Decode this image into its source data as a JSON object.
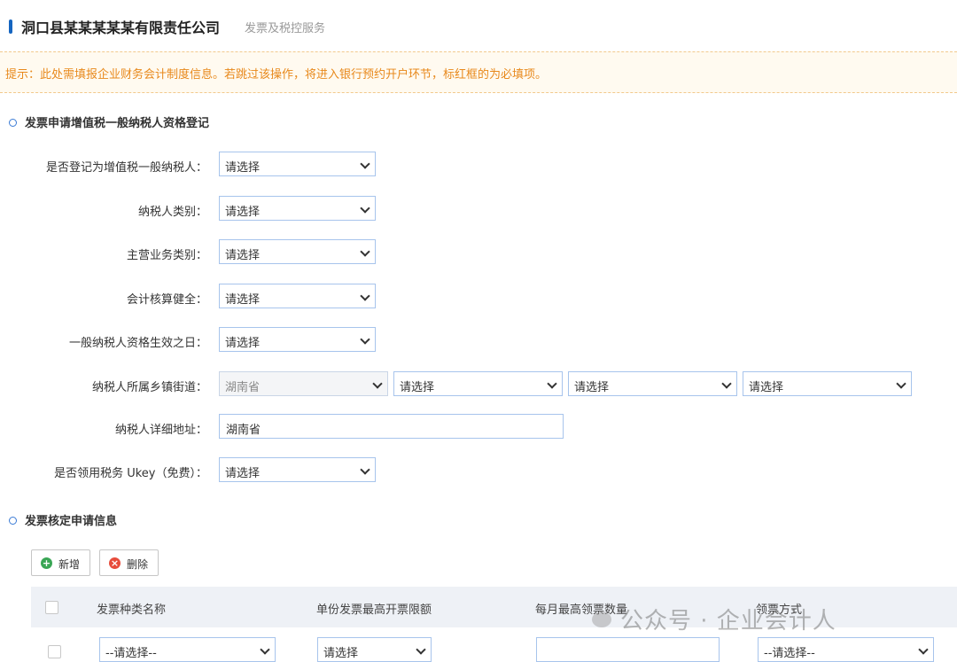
{
  "header": {
    "company": "洞口县某某某某某有限责任公司",
    "subtitle": "发票及税控服务"
  },
  "tip": "提示：此处需填报企业财务会计制度信息。若跳过该操作，将进入银行预约开户环节，标红框的为必填项。",
  "section1": {
    "title": "发票申请增值税一般纳税人资格登记",
    "fields": [
      {
        "label": "是否登记为增值税一般纳税人：",
        "value": "请选择"
      },
      {
        "label": "纳税人类别：",
        "value": "请选择"
      },
      {
        "label": "主营业务类别：",
        "value": "请选择"
      },
      {
        "label": "会计核算健全：",
        "value": "请选择"
      },
      {
        "label": "一般纳税人资格生效之日：",
        "value": "请选择"
      }
    ],
    "street": {
      "label": "纳税人所属乡镇街道：",
      "province": "湖南省",
      "city": "请选择",
      "county": "请选择",
      "town": "请选择"
    },
    "address": {
      "label": "纳税人详细地址：",
      "value": "湖南省"
    },
    "ukey": {
      "label": "是否领用税务 Ukey（免费）：",
      "value": "请选择"
    }
  },
  "section2": {
    "title": "发票核定申请信息",
    "add_label": "新增",
    "delete_label": "删除",
    "columns": [
      "发票种类名称",
      "单份发票最高开票限额",
      "每月最高领票数量",
      "领票方式"
    ],
    "row": {
      "type": "--请选择--",
      "limit": "请选择",
      "quantity": "",
      "method": "--请选择--"
    }
  },
  "watermark": "公众号 · 企业会计人"
}
